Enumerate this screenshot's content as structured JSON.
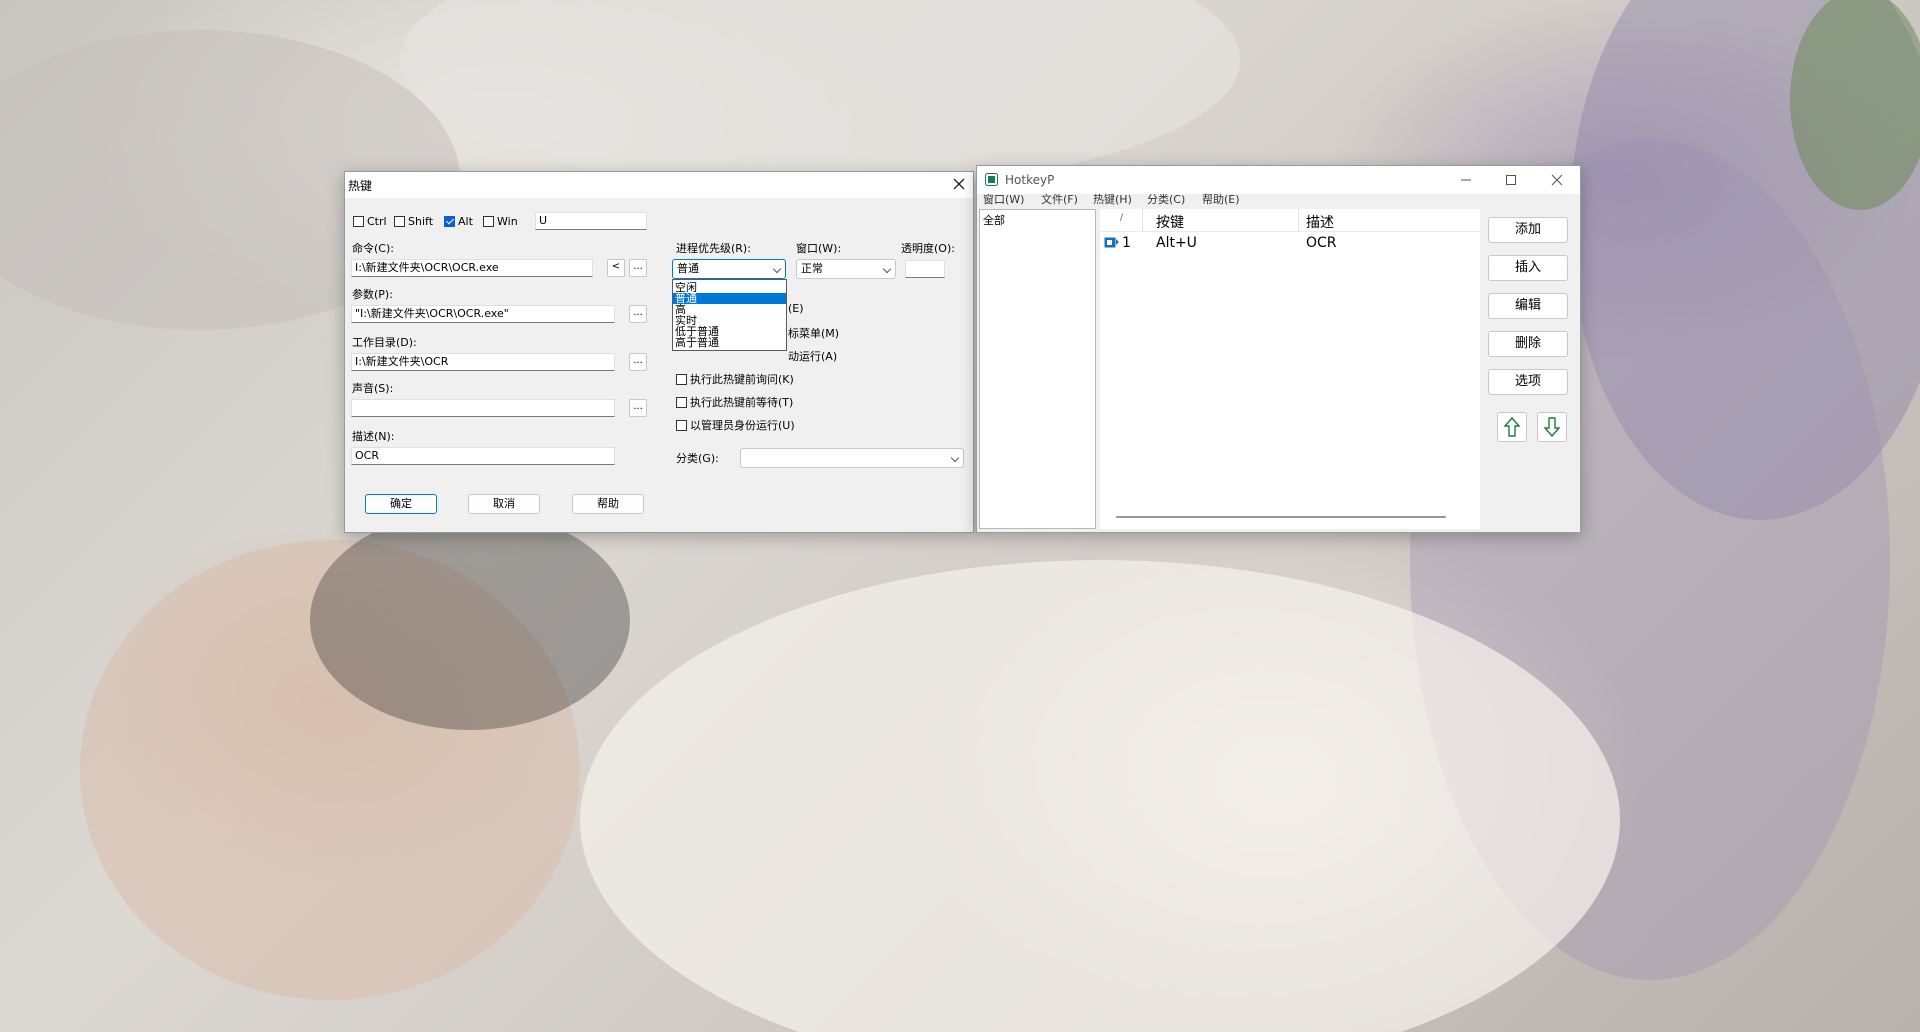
{
  "dialog": {
    "title": "热键",
    "modifiers": [
      {
        "label": "Ctrl",
        "checked": false
      },
      {
        "label": "Shift",
        "checked": false
      },
      {
        "label": "Alt",
        "checked": true
      },
      {
        "label": "Win",
        "checked": false
      }
    ],
    "key_value": "U",
    "command_label": "命令(C):",
    "command_value": "I:\\新建文件夹\\OCR\\OCR.exe",
    "args_label": "参数(P):",
    "args_value": "\"I:\\新建文件夹\\OCR\\OCR.exe\"",
    "workdir_label": "工作目录(D):",
    "workdir_value": "I:\\新建文件夹\\OCR",
    "sound_label": "声音(S):",
    "sound_value": "",
    "desc_label": "描述(N):",
    "desc_value": "OCR",
    "priority_label": "进程优先级(R):",
    "priority_value": "普通",
    "priority_options": [
      "空闲",
      "普通",
      "高",
      "实时",
      "低于普通",
      "高于普通"
    ],
    "priority_selected_index": 1,
    "window_label": "窗口(W):",
    "window_value": "正常",
    "opacity_label": "透明度(O):",
    "opacity_value": "",
    "partial_options": [
      "(E)",
      "标菜单(M)",
      "动运行(A)"
    ],
    "options": [
      {
        "label": "执行此热键前询问(K)",
        "checked": false
      },
      {
        "label": "执行此热键前等待(T)",
        "checked": false
      },
      {
        "label": "以管理员身份运行(U)",
        "checked": false
      }
    ],
    "category_label": "分类(G):",
    "category_value": "",
    "ok_label": "确定",
    "cancel_label": "取消",
    "help_label": "帮助",
    "back_button_label": "<",
    "browse_button_label": "..."
  },
  "main": {
    "title": "HotkeyP",
    "menu": [
      "窗口(W)",
      "文件(F)",
      "热键(H)",
      "分类(C)",
      "帮助(E)"
    ],
    "categories": [
      "全部"
    ],
    "columns": {
      "sort": "/",
      "hotkey": "按键",
      "description": "描述"
    },
    "rows": [
      {
        "num": "1",
        "hotkey": "Alt+U",
        "description": "OCR"
      }
    ],
    "buttons": {
      "add": "添加",
      "insert": "插入",
      "edit": "编辑",
      "delete": "删除",
      "options": "选项"
    }
  }
}
